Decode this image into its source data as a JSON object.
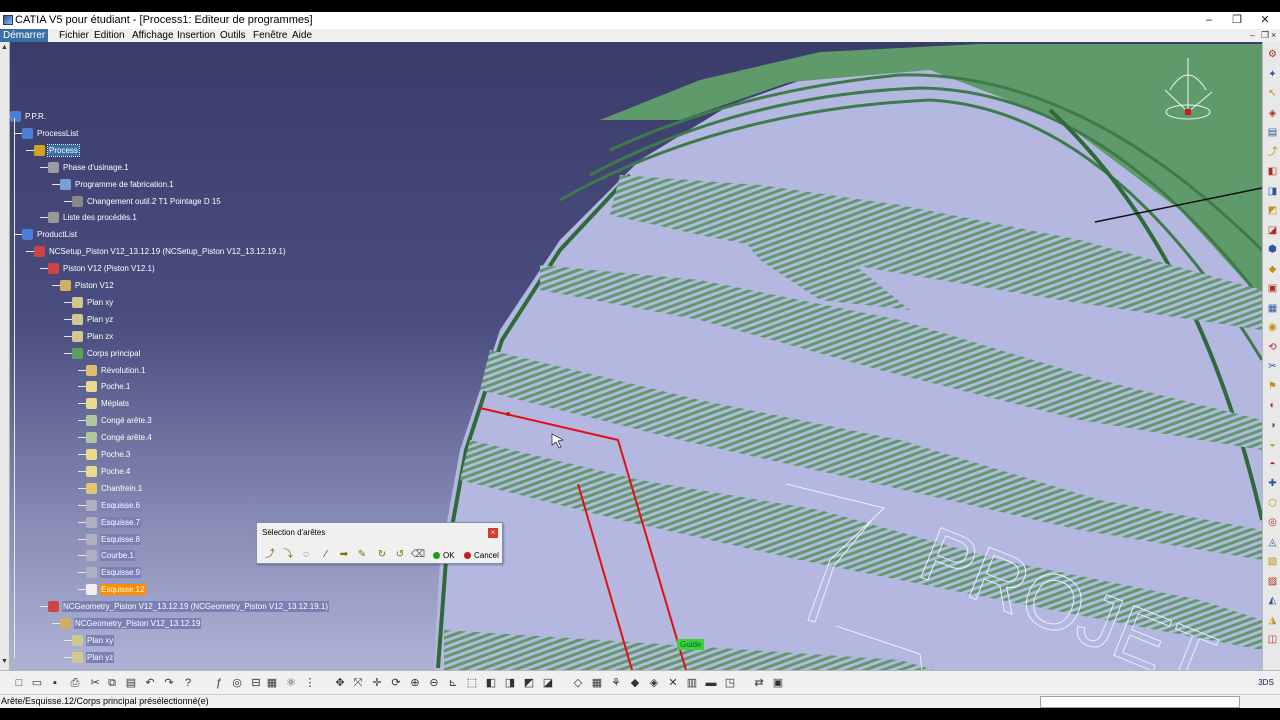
{
  "window": {
    "title": "CATIA V5 pour étudiant - [Process1: Editeur de programmes]",
    "min": "–",
    "max": "❐",
    "close": "✕"
  },
  "menu": {
    "items": [
      "Démarrer",
      "Fichier",
      "Edition",
      "Affichage",
      "Insertion",
      "Outils",
      "Fenêtre",
      "Aide"
    ]
  },
  "tree": {
    "nodes": [
      {
        "label": "P.P.R.",
        "icon": "ppr-icon",
        "color": "#4a7fd8"
      },
      {
        "label": "ProcessList",
        "icon": "processlist-icon",
        "color": "#4a7fd8"
      },
      {
        "label": "Process",
        "icon": "process-icon",
        "color": "#d4a020",
        "state": "sel"
      },
      {
        "label": "Phase d'usinage.1",
        "icon": "machining-phase-icon",
        "color": "#9a9aa8"
      },
      {
        "label": "Programme de fabrication.1",
        "icon": "program-icon",
        "color": "#7aa0d8"
      },
      {
        "label": "Changement outil.2  T1 Pointage D 15",
        "icon": "tool-change-icon",
        "color": "#888"
      },
      {
        "label": "Liste des procédés.1",
        "icon": "process-list-icon",
        "color": "#999"
      },
      {
        "label": "ProductList",
        "icon": "productlist-icon",
        "color": "#4a7fd8"
      },
      {
        "label": "NCSetup_Piston V12_13.12.19 (NCSetup_Piston V12_13.12.19.1)",
        "icon": "product-icon",
        "color": "#c44"
      },
      {
        "label": "Piston V12 (Piston V12.1)",
        "icon": "product-icon",
        "color": "#c44"
      },
      {
        "label": "Piston V12",
        "icon": "part-icon",
        "color": "#d0b060"
      },
      {
        "label": "Plan xy",
        "icon": "plane-icon",
        "color": "#d0c890"
      },
      {
        "label": "Plan yz",
        "icon": "plane-icon",
        "color": "#d0c890"
      },
      {
        "label": "Plan zx",
        "icon": "plane-icon",
        "color": "#d0c890"
      },
      {
        "label": "Corps principal",
        "icon": "body-icon",
        "color": "#5aa05a"
      },
      {
        "label": "Révolution.1",
        "icon": "revolution-icon",
        "color": "#d8c070"
      },
      {
        "label": "Poche.1",
        "icon": "pocket-icon",
        "color": "#e8d890"
      },
      {
        "label": "Méplats",
        "icon": "pocket-icon",
        "color": "#e8d890"
      },
      {
        "label": "Congé arête.3",
        "icon": "fillet-icon",
        "color": "#b0c8a0"
      },
      {
        "label": "Congé arête.4",
        "icon": "fillet-icon",
        "color": "#b0c8a0"
      },
      {
        "label": "Poche.3",
        "icon": "pocket-icon",
        "color": "#e8d890"
      },
      {
        "label": "Poche.4",
        "icon": "pocket-icon",
        "color": "#e8d890"
      },
      {
        "label": "Chanfrein.1",
        "icon": "chamfer-icon",
        "color": "#e0c870"
      },
      {
        "label": "Esquisse.6",
        "icon": "sketch-icon",
        "color": "#b0b0c0",
        "state": "hl"
      },
      {
        "label": "Esquisse.7",
        "icon": "sketch-icon",
        "color": "#b0b0c0",
        "state": "hl"
      },
      {
        "label": "Esquisse.8",
        "icon": "sketch-icon",
        "color": "#b0b0c0",
        "state": "hl"
      },
      {
        "label": "Courbe.1",
        "icon": "curve-icon",
        "color": "#b0b0c0",
        "state": "hl"
      },
      {
        "label": "Esquisse.9",
        "icon": "sketch-icon",
        "color": "#b0b0c0",
        "state": "hl"
      },
      {
        "label": "Esquisse.12",
        "icon": "sketch-icon",
        "color": "#f0f0f0",
        "state": "orange"
      },
      {
        "label": "NCGeometry_Piston V12_13.12.19 (NCGeometry_Piston V12_13.12.19.1)",
        "icon": "product-icon",
        "color": "#c44",
        "state": "hl"
      },
      {
        "label": "NCGeometry_Piston V12_13.12.19",
        "icon": "part-icon",
        "color": "#d0b060",
        "state": "hl"
      },
      {
        "label": "Plan xy",
        "icon": "plane-icon",
        "color": "#d0c890",
        "state": "hl"
      },
      {
        "label": "Plan yz",
        "icon": "plane-icon",
        "color": "#d0c890",
        "state": "hl"
      }
    ]
  },
  "dialog": {
    "title": "Sélection d'arêtes",
    "close": "×",
    "ok": "OK",
    "cancel": "Cancel"
  },
  "viewport": {
    "guide_label": "Guide",
    "engraving_text": "PROJET"
  },
  "status": {
    "text": "Arête/Esquisse.12/Corps principal présélectionné(e)"
  },
  "colors": {
    "part_green": "#5f9b6a",
    "part_face": "#b4b8e0",
    "guide_red": "#e01010",
    "selection_blue": "#3a6ea5"
  }
}
